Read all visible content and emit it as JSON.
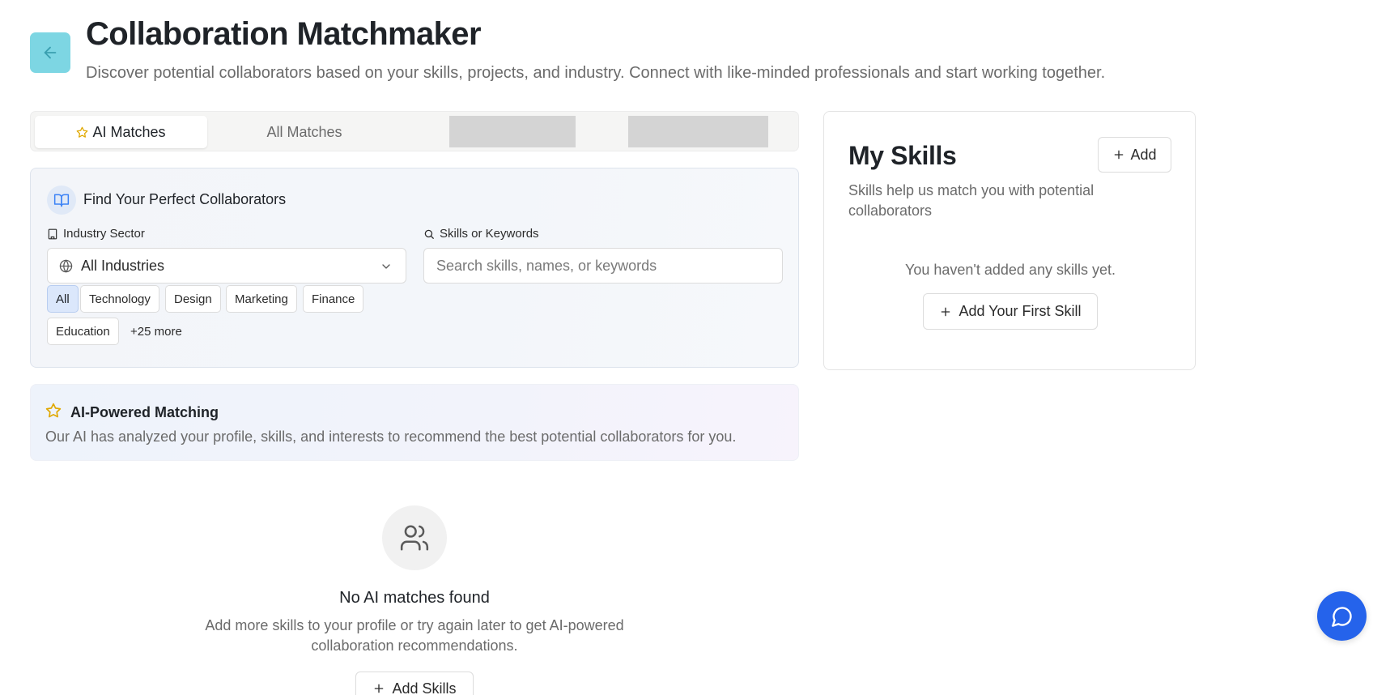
{
  "header": {
    "title": "Collaboration Matchmaker",
    "subtitle": "Discover potential collaborators based on your skills, projects, and industry. Connect with like-minded professionals and start working together.",
    "back_icon": "arrow-left-icon"
  },
  "tabs": [
    {
      "label": "AI Matches",
      "active": true,
      "icon": "star-icon"
    },
    {
      "label": "All Matches",
      "active": false
    }
  ],
  "filters": {
    "title": "Find Your Perfect Collaborators",
    "industry_label": "Industry Sector",
    "industry_value": "All Industries",
    "search_label": "Skills or Keywords",
    "search_placeholder": "Search skills, names, or keywords",
    "chips": [
      "All",
      "Technology",
      "Design",
      "Marketing",
      "Finance",
      "Education"
    ],
    "more_label": "+25 more"
  },
  "ai_banner": {
    "title": "AI-Powered Matching",
    "description": "Our AI has analyzed your profile, skills, and interests to recommend the best potential collaborators for you."
  },
  "empty_state": {
    "title": "No AI matches found",
    "description": "Add more skills to your profile or try again later to get AI-powered collaboration recommendations.",
    "button_label": "Add Skills"
  },
  "skills_card": {
    "title": "My Skills",
    "add_label": "Add",
    "description": "Skills help us match you with potential collaborators",
    "empty_text": "You haven't added any skills yet.",
    "first_button_label": "Add Your First Skill"
  },
  "colors": {
    "back_button": "#7dd6e3",
    "accent_blue": "#2563eb",
    "star_gold": "#e0a800",
    "active_chip": "#dbe7fb"
  }
}
